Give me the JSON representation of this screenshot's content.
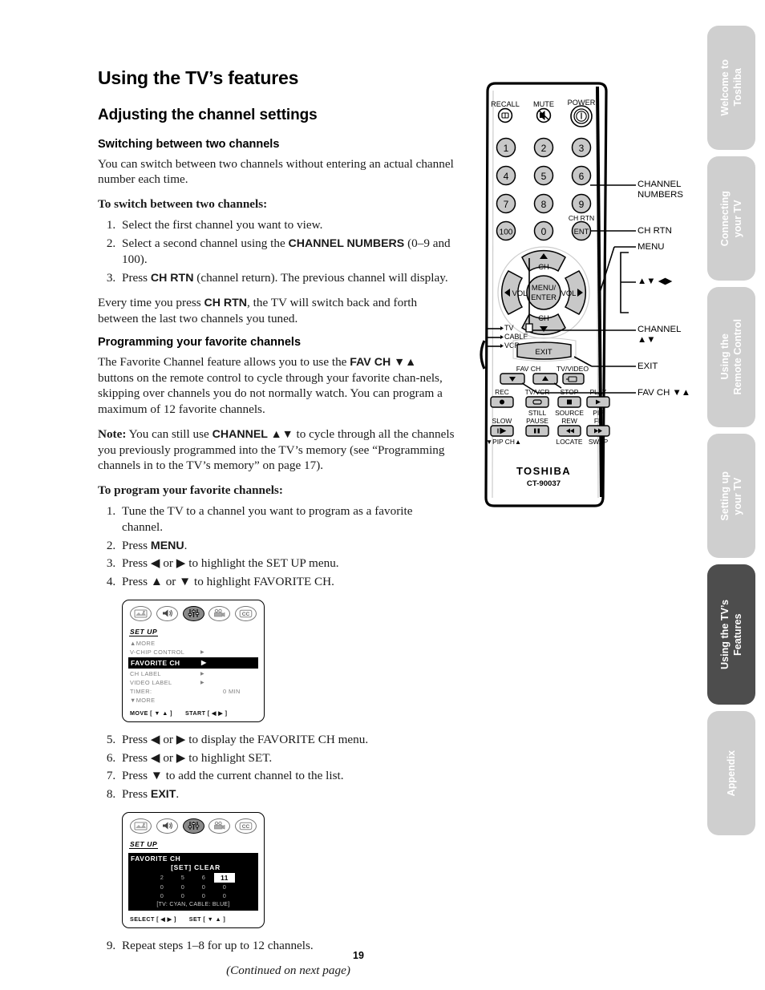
{
  "page": {
    "number": "19",
    "title": "Using the TV’s features",
    "section": "Adjusting the channel settings",
    "continued": "(Continued on next page)"
  },
  "content": {
    "sub1": {
      "heading": "Switching between two channels",
      "intro": "You can switch between two channels without entering an actual channel number each time.",
      "leadin": "To switch between two channels:",
      "steps": [
        "Select the first channel you want to view.",
        "Select a second channel using the CHANNEL NUMBERS (0–9 and 100).",
        "Press CH RTN (channel return). The previous channel will display."
      ],
      "outro": "Every time you press CH RTN, the TV will switch back and forth between the last two channels you tuned."
    },
    "sub2": {
      "heading": "Programming your favorite channels",
      "intro": "The Favorite Channel feature allows you to use the FAV CH ▼▲ buttons on the remote control to cycle through your favorite channels, skipping over channels you do not normally watch. You can program a maximum of 12 favorite channels.",
      "note_label": "Note:",
      "note": "You can still use CHANNEL ▲▼ to cycle through all the channels you previously programmed into the TV’s memory (see “Programming channels in to the TV’s memory” on page 17).",
      "leadin": "To program your favorite channels:",
      "steps": [
        "Tune the TV to a channel you want to program as a favorite channel.",
        "Press MENU.",
        "Press ◀ or ▶ to highlight the SET UP menu.",
        "Press ▲ or ▼ to highlight FAVORITE CH.",
        "Press ◀ or ▶ to display the FAVORITE CH menu.",
        "Press ◀ or ▶ to highlight SET.",
        "Press ▼ to add the current channel to the list.",
        "Press EXIT.",
        "Repeat steps 1–8 for up to 12 channels."
      ]
    }
  },
  "osd_setup": {
    "icons": [
      "picture-icon",
      "audio-icon",
      "setup-icon",
      "video-icon",
      "cc-icon"
    ],
    "active_icon_index": 2,
    "menu_title": "SET UP",
    "rows": [
      {
        "label": "▲MORE",
        "arrow": "",
        "value": "",
        "highlighted": false
      },
      {
        "label": "V-CHIP CONTROL",
        "arrow": "▶",
        "value": "",
        "highlighted": false
      },
      {
        "label": "FAVORITE CH",
        "arrow": "▶",
        "value": "",
        "highlighted": true
      },
      {
        "label": "CH LABEL",
        "arrow": "▶",
        "value": "",
        "highlighted": false
      },
      {
        "label": "VIDEO LABEL",
        "arrow": "▶",
        "value": "",
        "highlighted": false
      },
      {
        "label": "TIMER:",
        "arrow": "",
        "value": "0 MIN",
        "highlighted": false
      },
      {
        "label": "▼MORE",
        "arrow": "",
        "value": "",
        "highlighted": false
      }
    ],
    "footer_left": "MOVE [ ▼ ▲ ]",
    "footer_right": "START [ ◀ ▶ ]"
  },
  "osd_favorite": {
    "icons": [
      "picture-icon",
      "audio-icon",
      "setup-icon",
      "video-icon",
      "cc-icon"
    ],
    "active_icon_index": 2,
    "menu_title": "SET UP",
    "panel_title": "FAVORITE CH",
    "set_clear": "[SET] CLEAR",
    "grid": [
      [
        "2",
        "5",
        "6",
        "11"
      ],
      [
        "0",
        "0",
        "0",
        "0"
      ],
      [
        "0",
        "0",
        "0",
        "0"
      ]
    ],
    "selected_cell": {
      "row": 0,
      "col": 3
    },
    "note": "[TV: CYAN,  CABLE: BLUE]",
    "footer_left": "SELECT [ ◀ ▶ ]",
    "footer_right": "SET [ ▼ ▲ ]"
  },
  "remote": {
    "brand": "TOSHIBA",
    "model": "CT-90037",
    "top_labels": {
      "recall": "RECALL",
      "mute": "MUTE",
      "power": "POWER"
    },
    "keypad": [
      "1",
      "2",
      "3",
      "4",
      "5",
      "6",
      "7",
      "8",
      "9",
      "100",
      "0",
      "ENT"
    ],
    "ent_label": "CH RTN",
    "dpad": {
      "up": "CH",
      "down": "CH",
      "left": "VOL",
      "right": "VOL",
      "center": "MENU/\nENTER"
    },
    "mode_labels": [
      "TV",
      "CABLE",
      "VCR"
    ],
    "exit_label": "EXIT",
    "fav_ch_label": "FAV CH",
    "tv_video_label": "TV/VIDEO",
    "vcr_row1": [
      "REC",
      "TV/VCR",
      "STOP",
      "PLAY"
    ],
    "vcr_row2_top": [
      "",
      "STILL",
      "SOURCE",
      "PIP"
    ],
    "vcr_row2": [
      "SLOW",
      "PAUSE",
      "REW",
      "FF"
    ],
    "vcr_row3": [
      "▼PIP CH▲",
      "LOCATE",
      "SWAP"
    ],
    "callouts": [
      "CHANNEL\nNUMBERS",
      "CH RTN",
      "MENU",
      "▲▼ ◀▶",
      "CHANNEL\n▲▼",
      "EXIT",
      "FAV CH ▼▲"
    ]
  },
  "sidebar": {
    "tabs": [
      {
        "label": "Welcome to\nToshiba",
        "active": false
      },
      {
        "label": "Connecting\nyour TV",
        "active": false
      },
      {
        "label": "Using the\nRemote Control",
        "active": false
      },
      {
        "label": "Setting up\nyour TV",
        "active": false
      },
      {
        "label": "Using the TV’s\nFeatures",
        "active": true
      },
      {
        "label": "Appendix",
        "active": false
      }
    ]
  },
  "colors": {
    "tab_inactive": "#cfcfcf",
    "tab_active": "#4d4d4d",
    "tab_text": "#ffffff",
    "button_gray": "#c8c8c8",
    "osd_dim": "#808080"
  }
}
